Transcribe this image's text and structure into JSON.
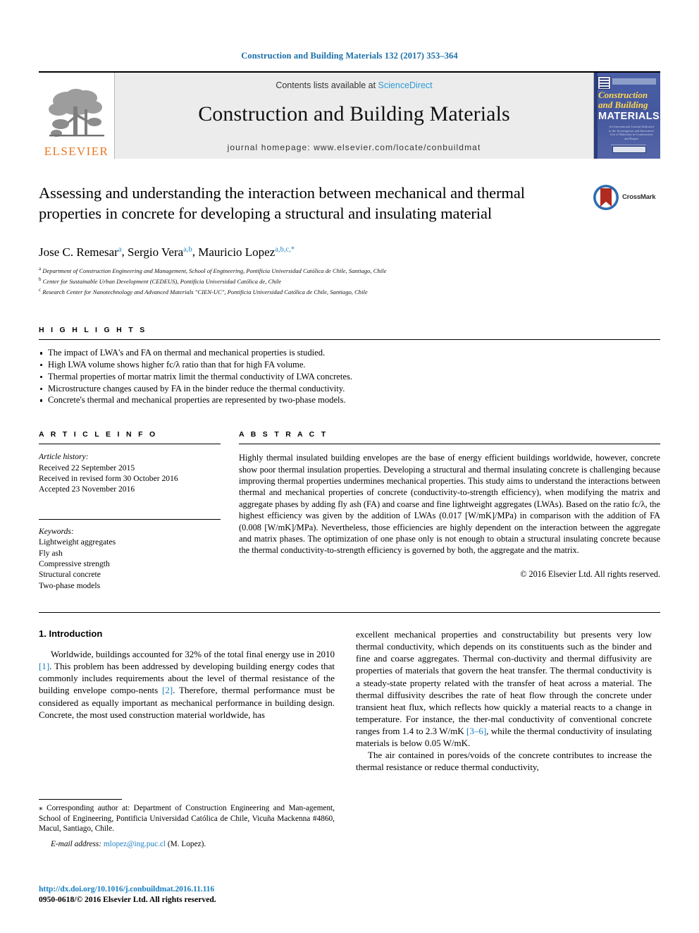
{
  "running_head": "Construction and Building Materials 132 (2017) 353–364",
  "masthead": {
    "elsevier_wordmark": "ELSEVIER",
    "contents_prefix": "Contents lists available at ",
    "sciencedirect": "ScienceDirect",
    "journal_title": "Construction and Building Materials",
    "journal_homepage": "journal homepage: www.elsevier.com/locate/conbuildmat",
    "cover": {
      "line1": "Construction",
      "line2": "and Building",
      "line3": "MATERIALS",
      "subtitle": "An International Journal dedicated to the Investigation and Innovative Use of Materials in Construction and Repair"
    }
  },
  "article": {
    "title": "Assessing and understanding the interaction between mechanical and thermal properties in concrete for developing a structural and insulating material",
    "crossmark_label": "CrossMark",
    "authors": [
      {
        "name": "Jose C. Remesar",
        "marks": "a"
      },
      {
        "name": "Sergio Vera",
        "marks": "a,b"
      },
      {
        "name": "Mauricio Lopez",
        "marks": "a,b,c,*"
      }
    ],
    "affiliations": [
      {
        "mark": "a",
        "text": "Department of Construction Engineering and Management, School of Engineering, Pontificia Universidad Católica de Chile, Santiago, Chile"
      },
      {
        "mark": "b",
        "text": "Center for Sustainable Urban Development (CEDEUS), Pontificia Universidad Católica de, Chile"
      },
      {
        "mark": "c",
        "text": "Research Center for Nanotechnology and Advanced Materials \"CIEN-UC\", Pontificia Universidad Católica de Chile, Santiago, Chile"
      }
    ]
  },
  "highlights": {
    "heading": "H I G H L I G H T S",
    "items": [
      "The impact of LWA's and FA on thermal and mechanical properties is studied.",
      "High LWA volume shows higher fc/λ ratio than that for high FA volume.",
      "Thermal properties of mortar matrix limit the thermal conductivity of LWA concretes.",
      "Microstructure changes caused by FA in the binder reduce the thermal conductivity.",
      "Concrete's thermal and mechanical properties are represented by two-phase models."
    ]
  },
  "article_info": {
    "heading": "A R T I C L E  I N F O",
    "history_label": "Article history:",
    "history": [
      "Received 22 September 2015",
      "Received in revised form 30 October 2016",
      "Accepted 23 November 2016"
    ],
    "keywords_label": "Keywords:",
    "keywords": [
      "Lightweight aggregates",
      "Fly ash",
      "Compressive strength",
      "Structural concrete",
      "Two-phase models"
    ]
  },
  "abstract": {
    "heading": "A B S T R A C T",
    "text": "Highly thermal insulated building envelopes are the base of energy efficient buildings worldwide, however, concrete show poor thermal insulation properties. Developing a structural and thermal insulating concrete is challenging because improving thermal properties undermines mechanical properties. This study aims to understand the interactions between thermal and mechanical properties of concrete (conductivity-to-strength efficiency), when modifying the matrix and aggregate phases by adding fly ash (FA) and coarse and fine lightweight aggregates (LWAs). Based on the ratio fc/λ, the highest efficiency was given by the addition of LWAs (0.017 [W/mK]/MPa) in comparison with the addition of FA (0.008 [W/mK]/MPa). Nevertheless, those efficiencies are highly dependent on the interaction between the aggregate and matrix phases. The optimization of one phase only is not enough to obtain a structural insulating concrete because the thermal conductivity-to-strength efficiency is governed by both, the aggregate and the matrix.",
    "copyright": "© 2016 Elsevier Ltd. All rights reserved."
  },
  "introduction": {
    "heading": "1. Introduction",
    "left_paragraph_part1": "Worldwide, buildings accounted for 32% of the total final energy use in 2010 ",
    "left_cite1": "[1]",
    "left_paragraph_part2": ". This problem has been addressed by developing building energy codes that commonly includes requirements about the level of thermal resistance of the building envelope compo-nents ",
    "left_cite2": "[2]",
    "left_paragraph_part3": ". Therefore, thermal performance must be considered as equally important as mechanical performance in building design. Concrete, the most used construction material worldwide, has",
    "right_paragraph_part1": "excellent mechanical properties and constructability but presents very low thermal conductivity, which depends on its constituents such as the binder and fine and coarse aggregates. Thermal con-ductivity and thermal diffusivity are properties of materials that govern the heat transfer. The thermal conductivity is a steady-state property related with the transfer of heat across a material. The thermal diffusivity describes the rate of heat flow through the concrete under transient heat flux, which reflects how quickly a material reacts to a change in temperature. For instance, the ther-mal conductivity of conventional concrete ranges from 1.4 to 2.3 W/mK ",
    "right_cite1": "[3–6]",
    "right_paragraph_part2": ", while the thermal conductivity of insulating materials is below 0.05 W/mK.",
    "right_paragraph2": "The air contained in pores/voids of the concrete contributes to increase the thermal resistance or reduce thermal conductivity,"
  },
  "footnote": {
    "text": "⁎ Corresponding author at: Department of Construction Engineering and Man-agement, School of Engineering, Pontificia Universidad Católica de Chile, Vicuña Mackenna #4860, Macul, Santiago, Chile.",
    "email_label": "E-mail address:",
    "email": "mlopez@ing.puc.cl",
    "email_suffix": "(M. Lopez)."
  },
  "publication": {
    "doi": "http://dx.doi.org/10.1016/j.conbuildmat.2016.11.116",
    "issn_line": "0950-0618/© 2016 Elsevier Ltd. All rights reserved."
  },
  "colors": {
    "link": "#1a7fc1",
    "running_head": "#1a6fa8",
    "elsevier_orange": "#E87722",
    "masthead_gray": "#ececec",
    "cover_blue": "#43589e",
    "crossmark_red": "#b02a20"
  }
}
